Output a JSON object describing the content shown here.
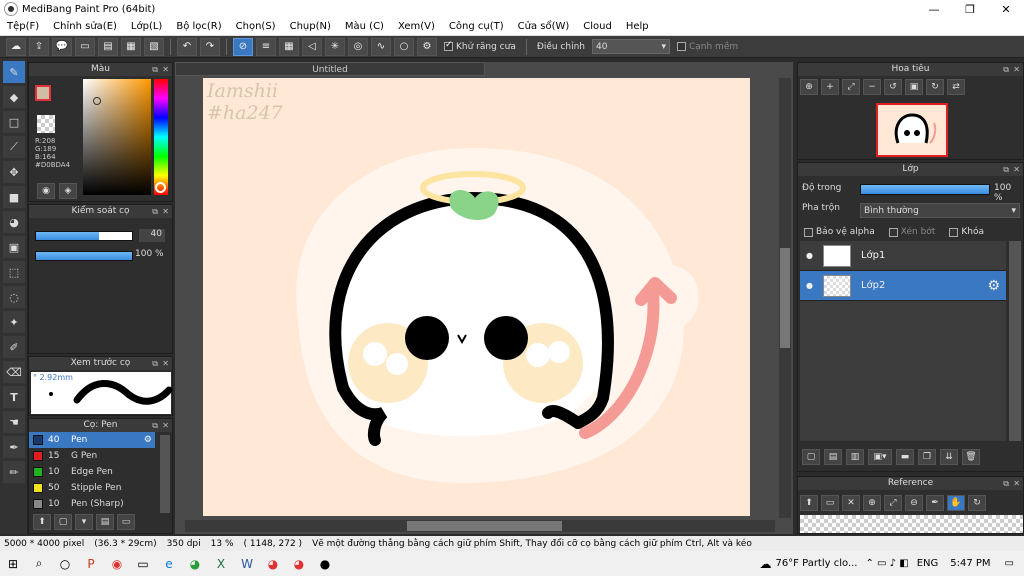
{
  "window": {
    "title": "MediBang Paint Pro (64bit)",
    "controls": [
      "—",
      "❐",
      "✕"
    ]
  },
  "menu": [
    "Tệp(F)",
    "Chỉnh sửa(E)",
    "Lớp(L)",
    "Bộ lọc(R)",
    "Chọn(S)",
    "Chụp(N)",
    "Màu (C)",
    "Xem(V)",
    "Công cụ(T)",
    "Cửa sổ(W)",
    "Cloud",
    "Help"
  ],
  "toolbar": {
    "antialias_label": "Khử răng cưa",
    "adjust_label": "Điều chỉnh",
    "adjust_value": "40",
    "soft_edge_label": "Cạnh mềm"
  },
  "color_panel": {
    "title": "Màu",
    "r": "R:208",
    "g": "G:189",
    "b": "B:164",
    "hex": "#D0BDA4",
    "fg_color": "#d0bda4",
    "accent": "#e0303a"
  },
  "brush_control": {
    "title": "Kiểm soát cọ",
    "size_value": "40",
    "opacity_value": "100 %",
    "size_fraction": 0.66,
    "opacity_fraction": 1.0
  },
  "brush_preview": {
    "title": "Xem trước cọ",
    "size": "° 2.92mm"
  },
  "brush_list": {
    "title": "Cọ: Pen",
    "items": [
      {
        "size": "40",
        "name": "Pen",
        "color": "#1a3a6a",
        "selected": true
      },
      {
        "size": "15",
        "name": "G Pen",
        "color": "#e02020",
        "selected": false
      },
      {
        "size": "10",
        "name": "Edge Pen",
        "color": "#20b020",
        "selected": false
      },
      {
        "size": "50",
        "name": "Stipple Pen",
        "color": "#f0e020",
        "selected": false
      },
      {
        "size": "10",
        "name": "Pen (Sharp)",
        "color": "#888888",
        "selected": false
      }
    ]
  },
  "document": {
    "tab": "Untitled",
    "watermark_line1": "Iamshii",
    "watermark_line2": "#ha247"
  },
  "navigator": {
    "title": "Hoa tiêu"
  },
  "layers": {
    "title": "Lớp",
    "opacity_label": "Độ trong",
    "opacity_value": "100 %",
    "opacity_fraction": 1.0,
    "blend_label": "Pha trộn",
    "blend_value": "Bình thường",
    "protect_alpha": "Bảo vệ alpha",
    "clipping": "Xén bớt",
    "lock": "Khóa",
    "items": [
      {
        "name": "Lớp1",
        "selected": false
      },
      {
        "name": "Lớp2",
        "selected": true
      }
    ]
  },
  "reference": {
    "title": "Reference"
  },
  "status": {
    "size": "5000 * 4000 pixel",
    "physical": "(36.3 * 29cm)",
    "dpi": "350 dpi",
    "zoom": "13 %",
    "cursor": "( 1148, 272 )",
    "hint": "Vẽ một đường thẳng bằng cách giữ phím Shift, Thay đổi cỡ cọ bằng cách giữ phím Ctrl, Alt và kéo"
  },
  "taskbar": {
    "weather": "76°F  Partly clo...",
    "lang": "ENG",
    "time": "5:47 PM"
  }
}
